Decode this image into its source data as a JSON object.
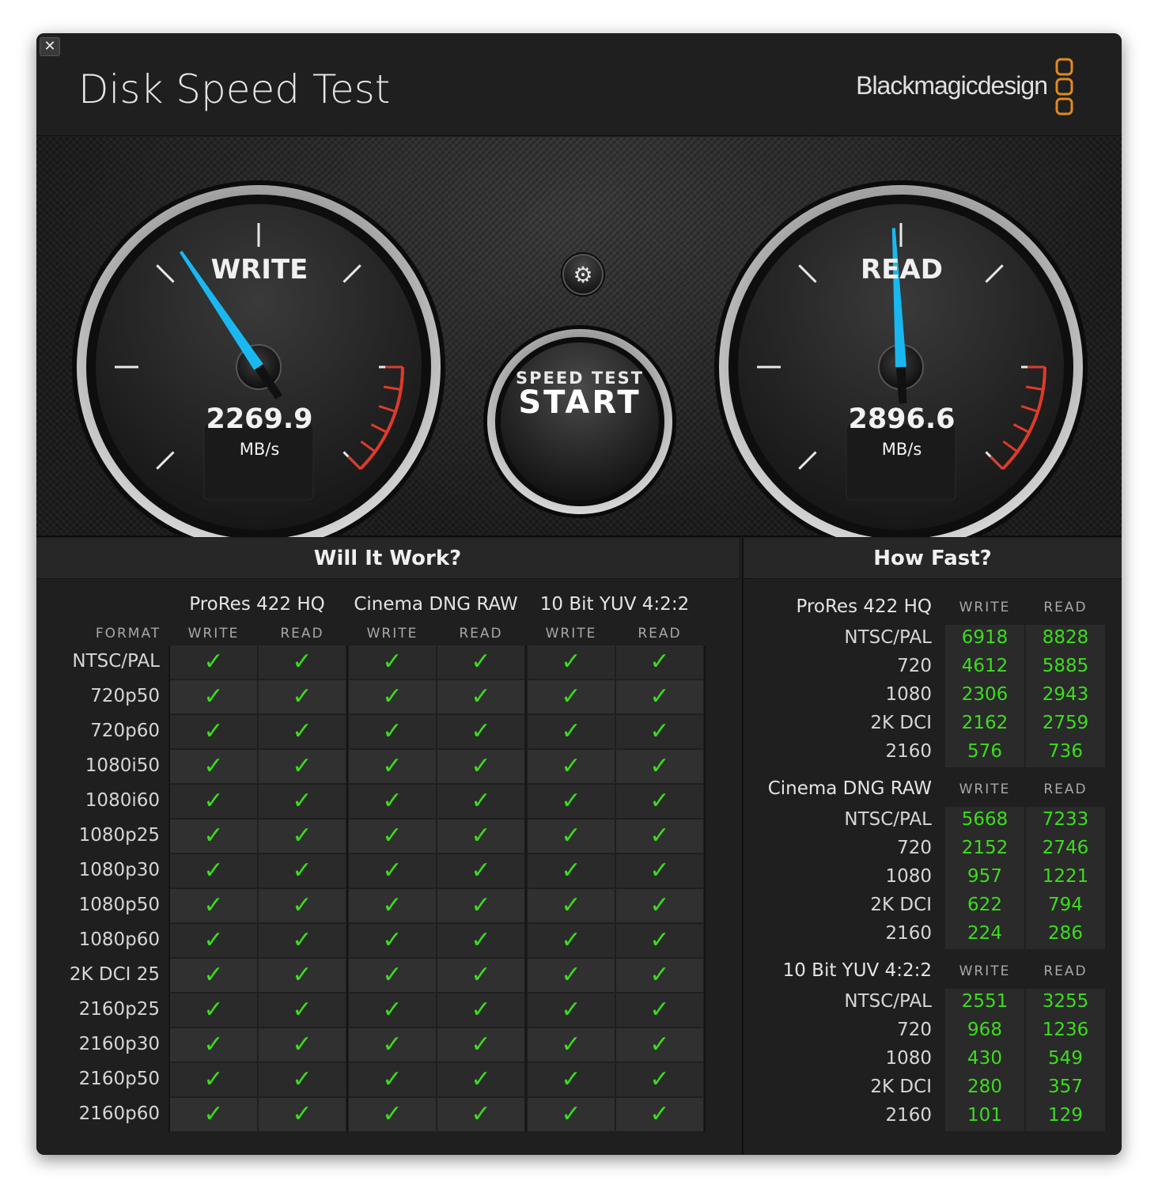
{
  "window": {
    "title": "Disk Speed Test",
    "close_label": "✕",
    "brand": "Blackmagicdesign"
  },
  "gauges": {
    "write": {
      "label": "WRITE",
      "value": "2269.9",
      "unit": "MB/s"
    },
    "read": {
      "label": "READ",
      "value": "2896.6",
      "unit": "MB/s"
    }
  },
  "start_button": {
    "line1": "SPEED TEST",
    "line2": "START"
  },
  "settings_icon": "gear-icon",
  "will_it_work": {
    "title": "Will It Work?",
    "format_label": "FORMAT",
    "groups": [
      "ProRes 422 HQ",
      "Cinema DNG RAW",
      "10 Bit YUV 4:2:2"
    ],
    "subcols": [
      "WRITE",
      "READ"
    ],
    "rows": [
      "NTSC/PAL",
      "720p50",
      "720p60",
      "1080i50",
      "1080i60",
      "1080p25",
      "1080p30",
      "1080p50",
      "1080p60",
      "2K DCI 25",
      "2160p25",
      "2160p30",
      "2160p50",
      "2160p60"
    ],
    "check_symbol": "✓"
  },
  "how_fast": {
    "title": "How Fast?",
    "write_label": "WRITE",
    "read_label": "READ",
    "groups": [
      {
        "name": "ProRes 422 HQ",
        "rows": [
          {
            "format": "NTSC/PAL",
            "write": "6918",
            "read": "8828"
          },
          {
            "format": "720",
            "write": "4612",
            "read": "5885"
          },
          {
            "format": "1080",
            "write": "2306",
            "read": "2943"
          },
          {
            "format": "2K DCI",
            "write": "2162",
            "read": "2759"
          },
          {
            "format": "2160",
            "write": "576",
            "read": "736"
          }
        ]
      },
      {
        "name": "Cinema DNG RAW",
        "rows": [
          {
            "format": "NTSC/PAL",
            "write": "5668",
            "read": "7233"
          },
          {
            "format": "720",
            "write": "2152",
            "read": "2746"
          },
          {
            "format": "1080",
            "write": "957",
            "read": "1221"
          },
          {
            "format": "2K DCI",
            "write": "622",
            "read": "794"
          },
          {
            "format": "2160",
            "write": "224",
            "read": "286"
          }
        ]
      },
      {
        "name": "10 Bit YUV 4:2:2",
        "rows": [
          {
            "format": "NTSC/PAL",
            "write": "2551",
            "read": "3255"
          },
          {
            "format": "720",
            "write": "968",
            "read": "1236"
          },
          {
            "format": "1080",
            "write": "430",
            "read": "549"
          },
          {
            "format": "2K DCI",
            "write": "280",
            "read": "357"
          },
          {
            "format": "2160",
            "write": "101",
            "read": "129"
          }
        ]
      }
    ]
  },
  "colors": {
    "needle": "#1ab8f0",
    "check_green": "#3cdc1e",
    "redline": "#e03a2a",
    "brand_orange": "#e08a20"
  }
}
